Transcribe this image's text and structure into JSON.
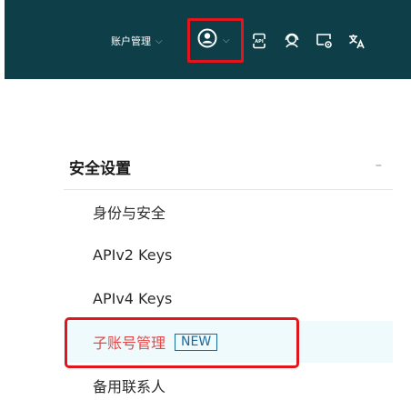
{
  "topbar": {
    "account_menu_label": "账户管理",
    "account_menu_chevron": "⌵",
    "user_chevron": "⌵"
  },
  "menu": {
    "section_title": "安全设置",
    "collapse_symbol": "–",
    "items": [
      {
        "label": "身份与安全"
      },
      {
        "label": "APIv2 Keys"
      },
      {
        "label": "APIv4 Keys"
      },
      {
        "label": "子账号管理",
        "badge": "NEW",
        "active": true
      },
      {
        "label": "备用联系人"
      }
    ]
  },
  "colors": {
    "topbar_bg": "#0e3f49",
    "active_text": "#e24a4a",
    "active_bg": "#eefafc",
    "badge": "#1b6a9e",
    "highlight": "#e2141c"
  }
}
